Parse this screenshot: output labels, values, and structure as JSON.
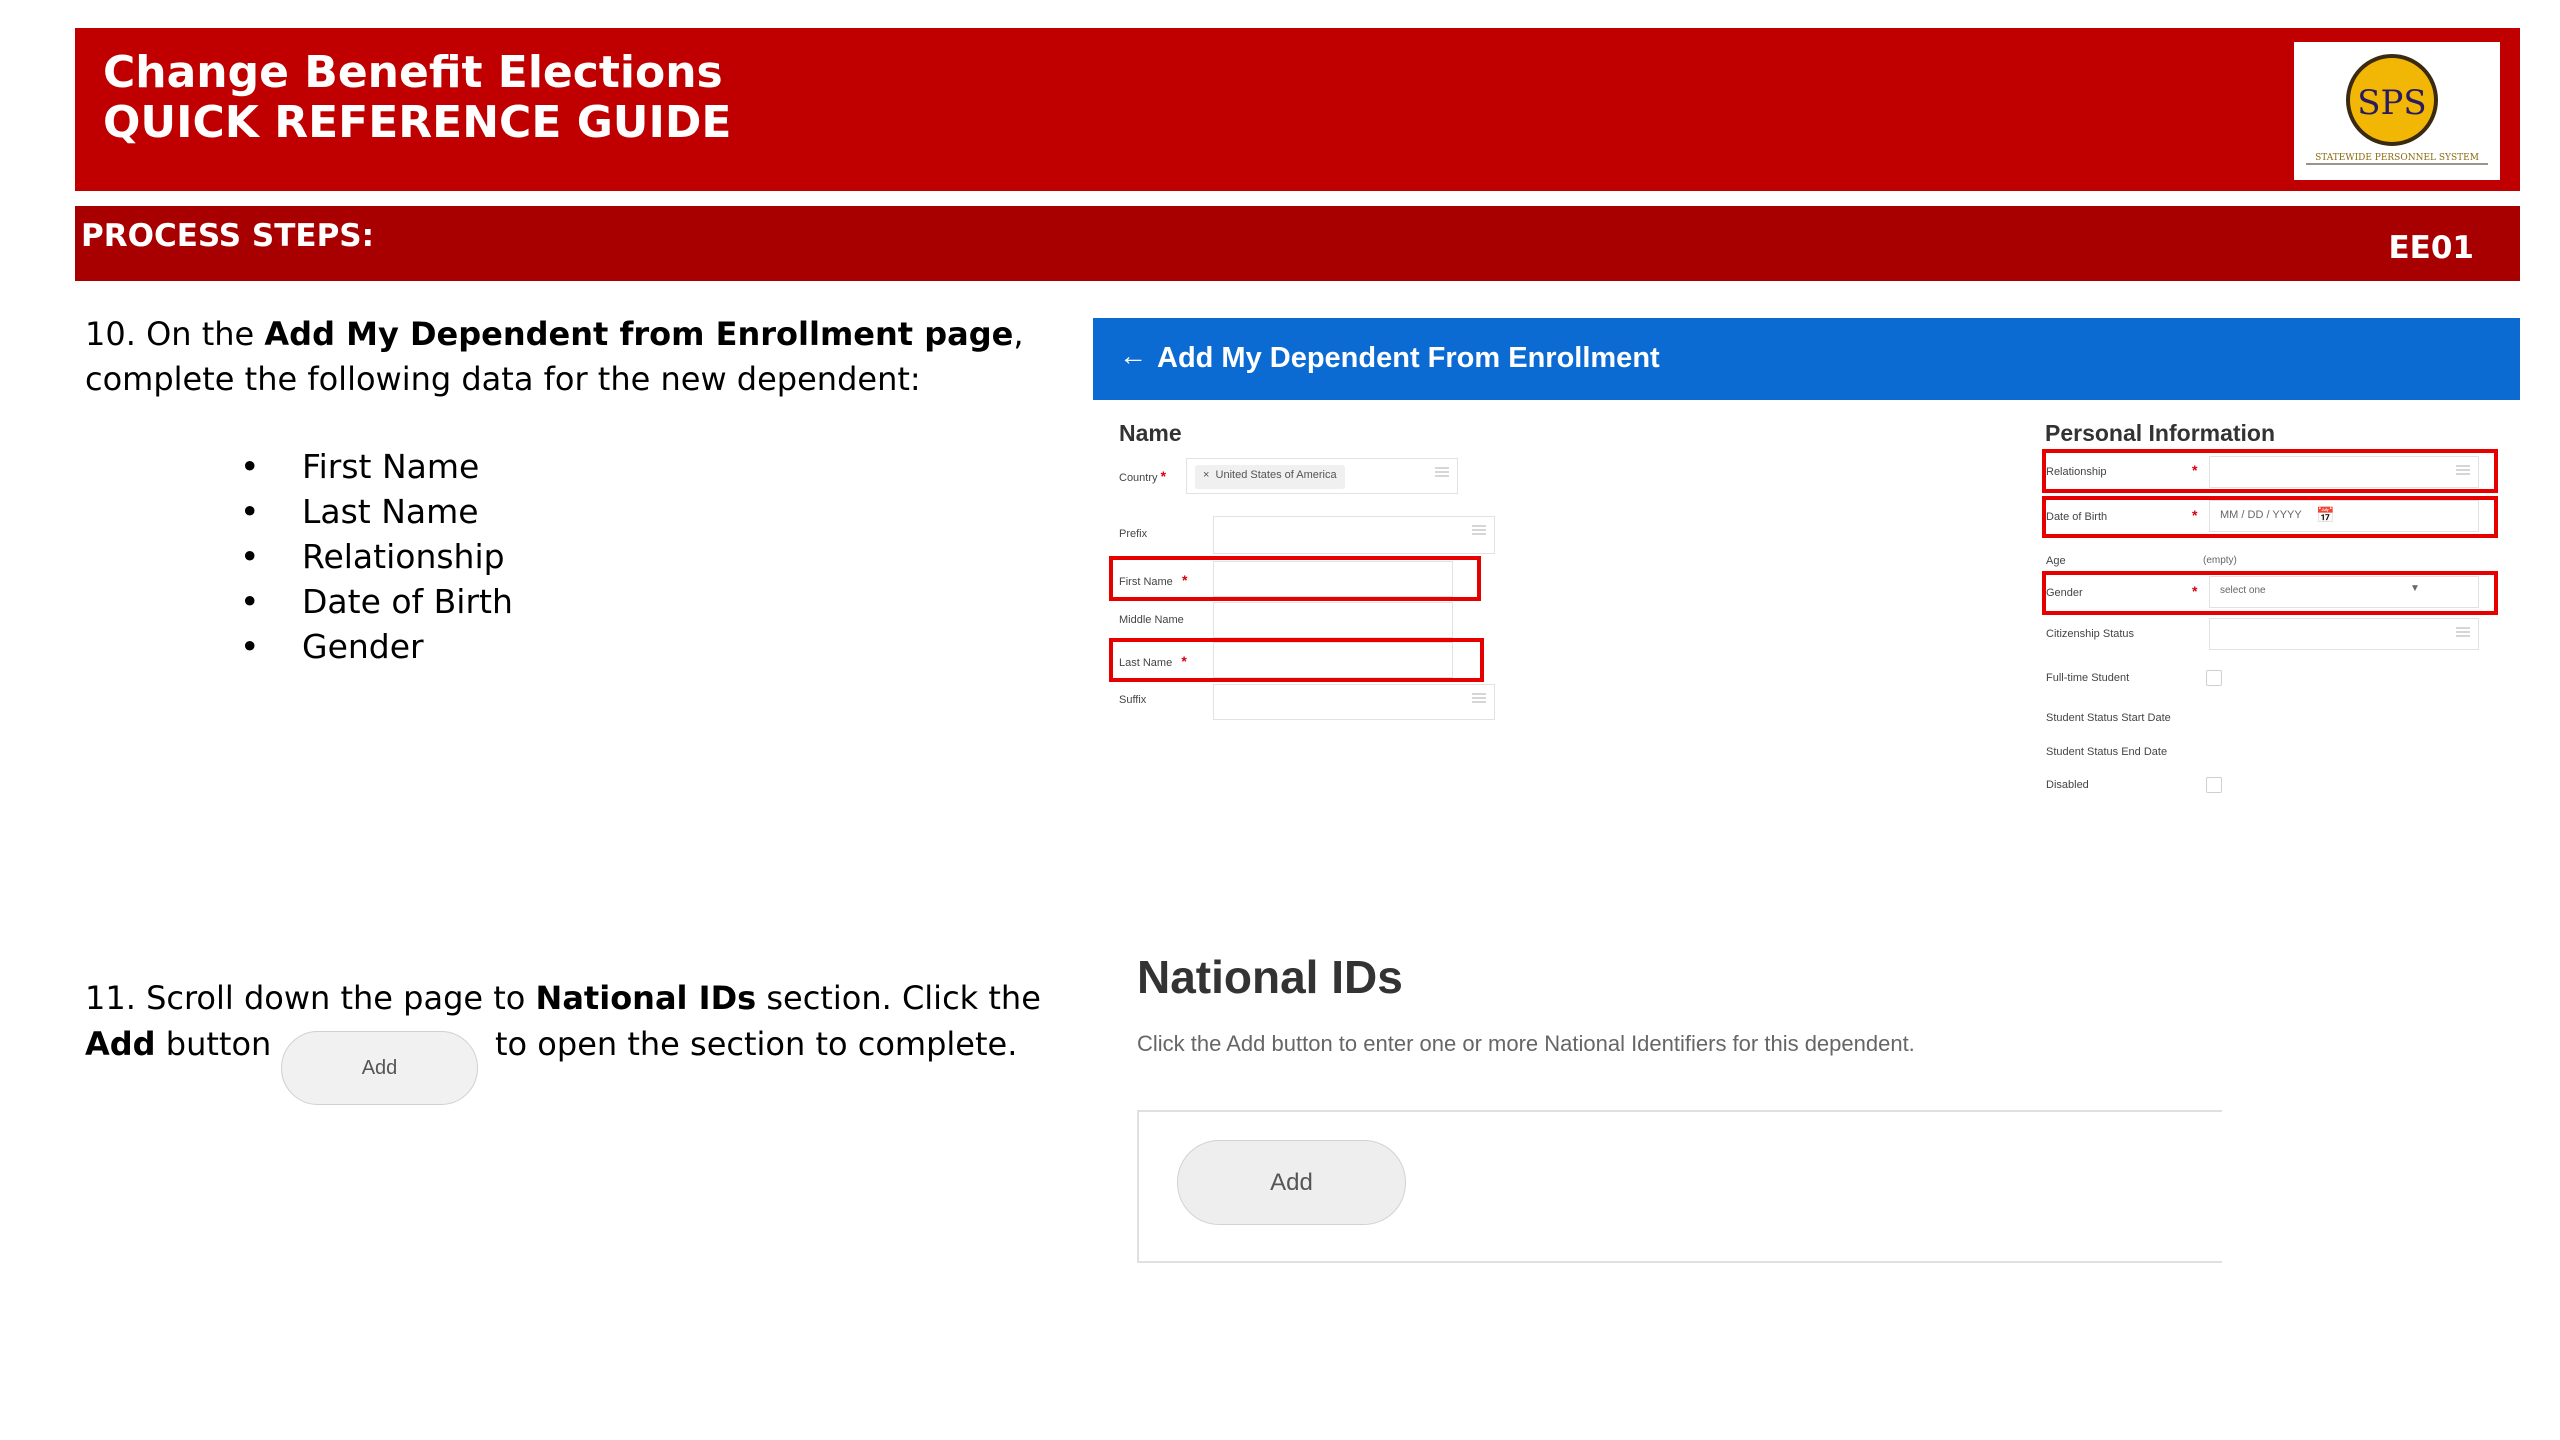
{
  "header": {
    "title_line1": "Change Benefit Elections",
    "title_line2": "QUICK REFERENCE GUIDE",
    "logo_text": "SPS",
    "logo_caption": "STATEWIDE PERSONNEL SYSTEM",
    "process_steps_label": "PROCESS STEPS:",
    "doc_code": "EE01"
  },
  "step10": {
    "number": "10.",
    "text_before": "On the",
    "bold": "Add My Dependent from Enrollment page",
    "text_after": ", complete the following data for the new dependent:",
    "bullets": [
      "First Name",
      "Last Name",
      "Relationship",
      "Date of Birth",
      "Gender"
    ]
  },
  "step11": {
    "number": "11.",
    "text1": "Scroll down the page to",
    "bold1": "National IDs",
    "text2": "section.  Click the",
    "bold2": "Add",
    "text3": "button",
    "text4": "to open the section to complete.",
    "inline_button": "Add"
  },
  "dependent_screen": {
    "header_title": "Add My Dependent From Enrollment",
    "name_section": {
      "title": "Name",
      "country_label": "Country",
      "country_value": "United States of America",
      "prefix_label": "Prefix",
      "first_name_label": "First Name",
      "middle_name_label": "Middle Name",
      "last_name_label": "Last Name",
      "suffix_label": "Suffix"
    },
    "personal_section": {
      "title": "Personal Information",
      "relationship_label": "Relationship",
      "dob_label": "Date of Birth",
      "dob_placeholder": "MM / DD / YYYY",
      "age_label": "Age",
      "age_value": "(empty)",
      "gender_label": "Gender",
      "gender_placeholder": "select one",
      "citizenship_label": "Citizenship Status",
      "fulltime_label": "Full-time Student",
      "student_start_label": "Student Status Start Date",
      "student_end_label": "Student Status End Date",
      "disabled_label": "Disabled"
    }
  },
  "national_ids": {
    "title": "National IDs",
    "description": "Click the Add button to enter one or more National Identifiers for this dependent.",
    "add_button": "Add"
  },
  "colors": {
    "banner_red": "#c00000",
    "steps_red": "#a80000",
    "workday_blue": "#0b6bd3",
    "highlight_red": "#e60000"
  }
}
